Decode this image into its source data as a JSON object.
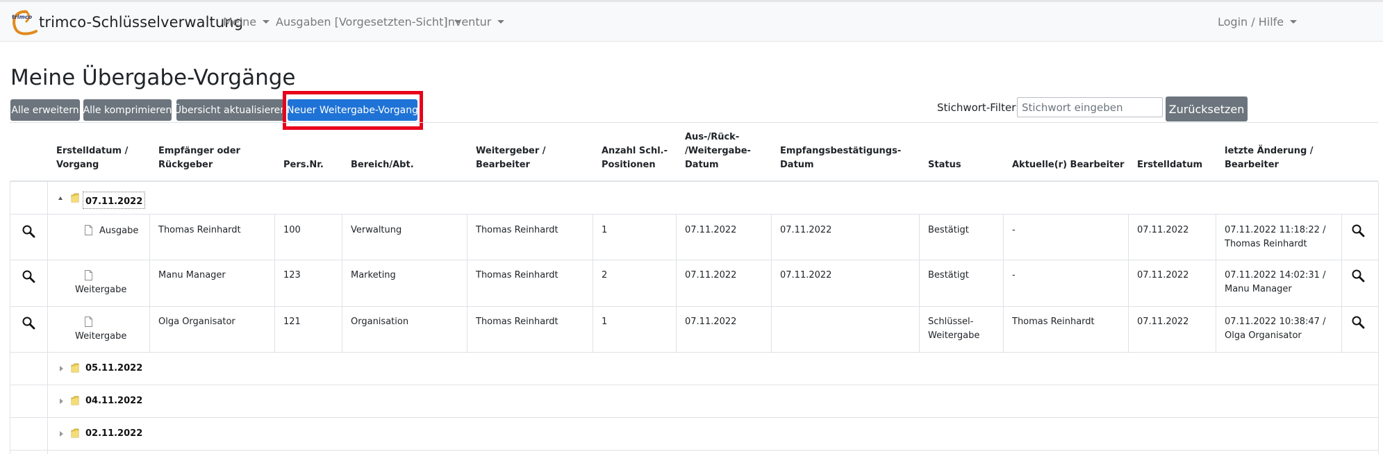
{
  "nav": {
    "brand": "trimco-Schlüsselverwaltung",
    "logo_text": "trimco",
    "menu": [
      "Meine",
      "Ausgaben [Vorgesetzten-Sicht]",
      "Inventur"
    ],
    "login": "Login / Hilfe"
  },
  "page": {
    "title": "Meine Übergabe-Vorgänge",
    "buttons": {
      "expand_all": "Alle erweitern",
      "collapse_all": "Alle komprimieren",
      "refresh": "Übersicht aktualisieren",
      "new_transfer": "Neuer Weitergabe-Vorgang"
    },
    "filter": {
      "label": "Stichwort-Filter:",
      "placeholder": "Stichwort eingeben",
      "value": "",
      "reset": "Zurücksetzen"
    },
    "accent_color": "#1f73d6",
    "highlight_color": "#e8001c"
  },
  "table": {
    "headers": [
      [
        "Erstelldatum /",
        "Vorgang"
      ],
      [
        "Empfänger oder",
        "Rückgeber"
      ],
      [
        "Pers.Nr."
      ],
      [
        "Bereich/Abt."
      ],
      [
        "Weitergeber /",
        "Bearbeiter"
      ],
      [
        "Anzahl Schl.-",
        "Positionen"
      ],
      [
        "Aus-/Rück-",
        "/Weitergabe-",
        "Datum"
      ],
      [
        "Empfangsbestätigungs-",
        "Datum"
      ],
      [
        "Status"
      ],
      [
        "Aktuelle(r) Bearbeiter"
      ],
      [
        "Erstelldatum"
      ],
      [
        "letzte Änderung /",
        "Bearbeiter"
      ]
    ],
    "open_group": "07.11.2022",
    "rows": [
      {
        "type": "Ausgabe",
        "recipient": "Thomas Reinhardt",
        "pers_nr": "100",
        "department": "Verwaltung",
        "giver": "Thomas Reinhardt",
        "count": "1",
        "transfer_date": "07.11.2022",
        "receipt_date": "07.11.2022",
        "status": [
          "Bestätigt"
        ],
        "current_editor": "-",
        "created": "07.11.2022",
        "last_change": [
          "07.11.2022 11:18:22 /",
          "Thomas Reinhardt"
        ]
      },
      {
        "type": "Weitergabe",
        "recipient": "Manu Manager",
        "pers_nr": "123",
        "department": "Marketing",
        "giver": "Thomas Reinhardt",
        "count": "2",
        "transfer_date": "07.11.2022",
        "receipt_date": "07.11.2022",
        "status": [
          "Bestätigt"
        ],
        "current_editor": "-",
        "created": "07.11.2022",
        "last_change": [
          "07.11.2022 14:02:31 /",
          "Manu Manager"
        ]
      },
      {
        "type": "Weitergabe",
        "recipient": "Olga Organisator",
        "pers_nr": "121",
        "department": "Organisation",
        "giver": "Thomas Reinhardt",
        "count": "1",
        "transfer_date": "07.11.2022",
        "receipt_date": "",
        "status": [
          "Schlüssel-",
          "Weitergabe"
        ],
        "current_editor": "Thomas Reinhardt",
        "created": "07.11.2022",
        "last_change": [
          "07.11.2022 10:38:47 /",
          "Olga Organisator"
        ]
      }
    ],
    "closed_groups": [
      "05.11.2022",
      "04.11.2022",
      "02.11.2022"
    ]
  }
}
